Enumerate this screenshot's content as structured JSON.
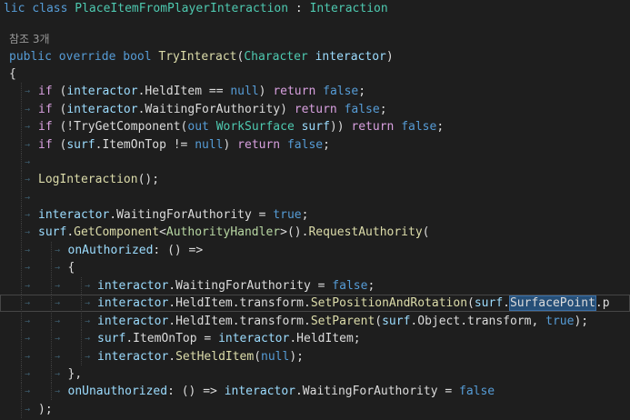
{
  "editor": {
    "lines": [
      {
        "tokens": [
          [
            "kw",
            "lic "
          ],
          [
            "kw",
            "class "
          ],
          [
            "type",
            "PlaceItemFromPlayerInteraction"
          ],
          [
            "plain",
            " : "
          ],
          [
            "type",
            "Interaction"
          ]
        ]
      },
      {
        "codelens": "참조 3개"
      },
      {
        "tokens": [
          [
            "kw",
            "public "
          ],
          [
            "kw",
            "override "
          ],
          [
            "kw",
            "bool "
          ],
          [
            "method",
            "TryInteract"
          ],
          [
            "plain",
            "("
          ],
          [
            "type",
            "Character "
          ],
          [
            "param",
            "interactor"
          ],
          [
            "plain",
            ")"
          ]
        ]
      },
      {
        "tokens": [
          [
            "plain",
            "{"
          ]
        ]
      },
      {
        "indent": 1,
        "tokens": [
          [
            "ctl",
            "if "
          ],
          [
            "plain",
            "("
          ],
          [
            "param",
            "interactor"
          ],
          [
            "plain",
            "."
          ],
          [
            "plain",
            "HeldItem"
          ],
          [
            "plain",
            " == "
          ],
          [
            "kw",
            "null"
          ],
          [
            "plain",
            ") "
          ],
          [
            "ctl",
            "return "
          ],
          [
            "kw",
            "false"
          ],
          [
            "plain",
            ";"
          ]
        ]
      },
      {
        "indent": 1,
        "tokens": [
          [
            "ctl",
            "if "
          ],
          [
            "plain",
            "("
          ],
          [
            "param",
            "interactor"
          ],
          [
            "plain",
            ".WaitingForAuthority) "
          ],
          [
            "ctl",
            "return "
          ],
          [
            "kw",
            "false"
          ],
          [
            "plain",
            ";"
          ]
        ]
      },
      {
        "indent": 1,
        "tokens": [
          [
            "ctl",
            "if "
          ],
          [
            "plain",
            "(!TryGetComponent("
          ],
          [
            "kw",
            "out "
          ],
          [
            "type",
            "WorkSurface "
          ],
          [
            "param",
            "surf"
          ],
          [
            "plain",
            ")) "
          ],
          [
            "ctl",
            "return "
          ],
          [
            "kw",
            "false"
          ],
          [
            "plain",
            ";"
          ]
        ]
      },
      {
        "indent": 1,
        "tokens": [
          [
            "ctl",
            "if "
          ],
          [
            "plain",
            "("
          ],
          [
            "param",
            "surf"
          ],
          [
            "plain",
            ".ItemOnTop != "
          ],
          [
            "kw",
            "null"
          ],
          [
            "plain",
            ") "
          ],
          [
            "ctl",
            "return "
          ],
          [
            "kw",
            "false"
          ],
          [
            "plain",
            ";"
          ]
        ]
      },
      {
        "indent": 1,
        "tokens": []
      },
      {
        "indent": 1,
        "tokens": [
          [
            "method",
            "LogInteraction"
          ],
          [
            "plain",
            "();"
          ]
        ]
      },
      {
        "indent": 1,
        "tokens": []
      },
      {
        "indent": 1,
        "tokens": [
          [
            "param",
            "interactor"
          ],
          [
            "plain",
            ".WaitingForAuthority = "
          ],
          [
            "kw",
            "true"
          ],
          [
            "plain",
            ";"
          ]
        ]
      },
      {
        "indent": 1,
        "tokens": [
          [
            "param",
            "surf"
          ],
          [
            "plain",
            "."
          ],
          [
            "method",
            "GetComponent"
          ],
          [
            "plain",
            "<"
          ],
          [
            "iface",
            "AuthorityHandler"
          ],
          [
            "plain",
            ">()."
          ],
          [
            "method",
            "RequestAuthority"
          ],
          [
            "plain",
            "("
          ]
        ]
      },
      {
        "indent": 2,
        "tokens": [
          [
            "param",
            "onAuthorized"
          ],
          [
            "plain",
            ": () =>"
          ]
        ]
      },
      {
        "indent": 2,
        "tokens": [
          [
            "plain",
            "{"
          ]
        ]
      },
      {
        "indent": 3,
        "tokens": [
          [
            "param",
            "interactor"
          ],
          [
            "plain",
            ".WaitingForAuthority = "
          ],
          [
            "kw",
            "false"
          ],
          [
            "plain",
            ";"
          ]
        ]
      },
      {
        "indent": 3,
        "current": true,
        "tokens": [
          [
            "param",
            "interactor"
          ],
          [
            "plain",
            ".HeldItem.transform."
          ],
          [
            "method",
            "SetPositionAndRotation"
          ],
          [
            "plain",
            "("
          ],
          [
            "param",
            "surf"
          ],
          [
            "plain",
            "."
          ],
          [
            "sel",
            "SurfacePoint"
          ],
          [
            "plain",
            ".p"
          ]
        ]
      },
      {
        "indent": 3,
        "tokens": [
          [
            "param",
            "interactor"
          ],
          [
            "plain",
            ".HeldItem.transform."
          ],
          [
            "method",
            "SetParent"
          ],
          [
            "plain",
            "("
          ],
          [
            "param",
            "surf"
          ],
          [
            "plain",
            ".Object.transform, "
          ],
          [
            "kw",
            "true"
          ],
          [
            "plain",
            ");"
          ]
        ]
      },
      {
        "indent": 3,
        "tokens": [
          [
            "param",
            "surf"
          ],
          [
            "plain",
            ".ItemOnTop = "
          ],
          [
            "param",
            "interactor"
          ],
          [
            "plain",
            ".HeldItem;"
          ]
        ]
      },
      {
        "indent": 3,
        "tokens": [
          [
            "param",
            "interactor"
          ],
          [
            "plain",
            "."
          ],
          [
            "method",
            "SetHeldItem"
          ],
          [
            "plain",
            "("
          ],
          [
            "kw",
            "null"
          ],
          [
            "plain",
            ");"
          ]
        ]
      },
      {
        "indent": 2,
        "tokens": [
          [
            "plain",
            "},"
          ]
        ]
      },
      {
        "indent": 2,
        "tokens": [
          [
            "param",
            "onUnauthorized"
          ],
          [
            "plain",
            ": () => "
          ],
          [
            "param",
            "interactor"
          ],
          [
            "plain",
            ".WaitingForAuthority = "
          ],
          [
            "kw",
            "false"
          ]
        ]
      },
      {
        "indent": 1,
        "tokens": [
          [
            "plain",
            ");"
          ]
        ]
      }
    ]
  }
}
